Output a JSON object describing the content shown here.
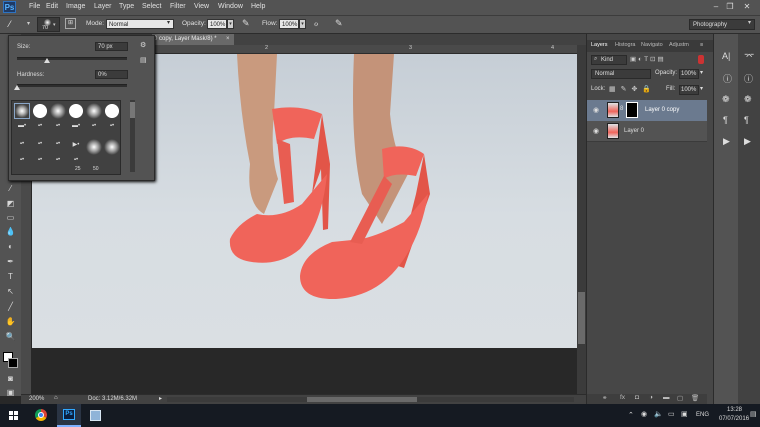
{
  "menubar": {
    "app_logo": "Ps",
    "items": [
      "File",
      "Edit",
      "Image",
      "Layer",
      "Type",
      "Select",
      "Filter",
      "View",
      "Window",
      "Help"
    ]
  },
  "options": {
    "brush_size": "70",
    "mode_label": "Mode:",
    "mode_value": "Normal",
    "opacity_label": "Opacity:",
    "opacity_value": "100%",
    "flow_label": "Flow:",
    "flow_value": "100%",
    "workspace_value": "Photography"
  },
  "brush_popup": {
    "size_label": "Size:",
    "size_value": "70 px",
    "size_fraction": 0.27,
    "hardness_label": "Hardness:",
    "hardness_value": "0%",
    "hardness_fraction": 0.0,
    "preset_labels": [
      "25",
      "50"
    ]
  },
  "document": {
    "tab_title": "0 copy, Layer Mask/8) *",
    "ruler_marks": [
      "2",
      "3",
      "4"
    ],
    "zoom": "200%",
    "doc_size": "Doc: 3.12M/6.32M"
  },
  "layers_panel": {
    "tabs": [
      "Layers",
      "Histogra",
      "Navigato",
      "Adjustm"
    ],
    "filter_kind": "Kind",
    "blend_mode": "Normal",
    "opacity_label": "Opacity:",
    "opacity_value": "100%",
    "lock_label": "Lock:",
    "fill_label": "Fill:",
    "fill_value": "100%",
    "layers": [
      {
        "name": "Layer 0 copy"
      },
      {
        "name": "Layer 0"
      }
    ],
    "footer_icons": [
      "link-icon",
      "fx-icon",
      "mask-icon",
      "adjustment-icon",
      "folder-icon",
      "new-layer-icon",
      "trash-icon"
    ]
  },
  "taskbar": {
    "time": "13:28",
    "date": "07/07/2016",
    "language": "ENG",
    "apps": [
      "windows-start-icon",
      "chrome-icon",
      "photoshop-icon",
      "file-explorer-icon"
    ]
  },
  "colors": {
    "shoe": "#f0645a",
    "skin": "#c99a7e",
    "floor": "#d6dce1",
    "ui_dark": "#535353",
    "selected_layer": "#6b7a8f"
  }
}
